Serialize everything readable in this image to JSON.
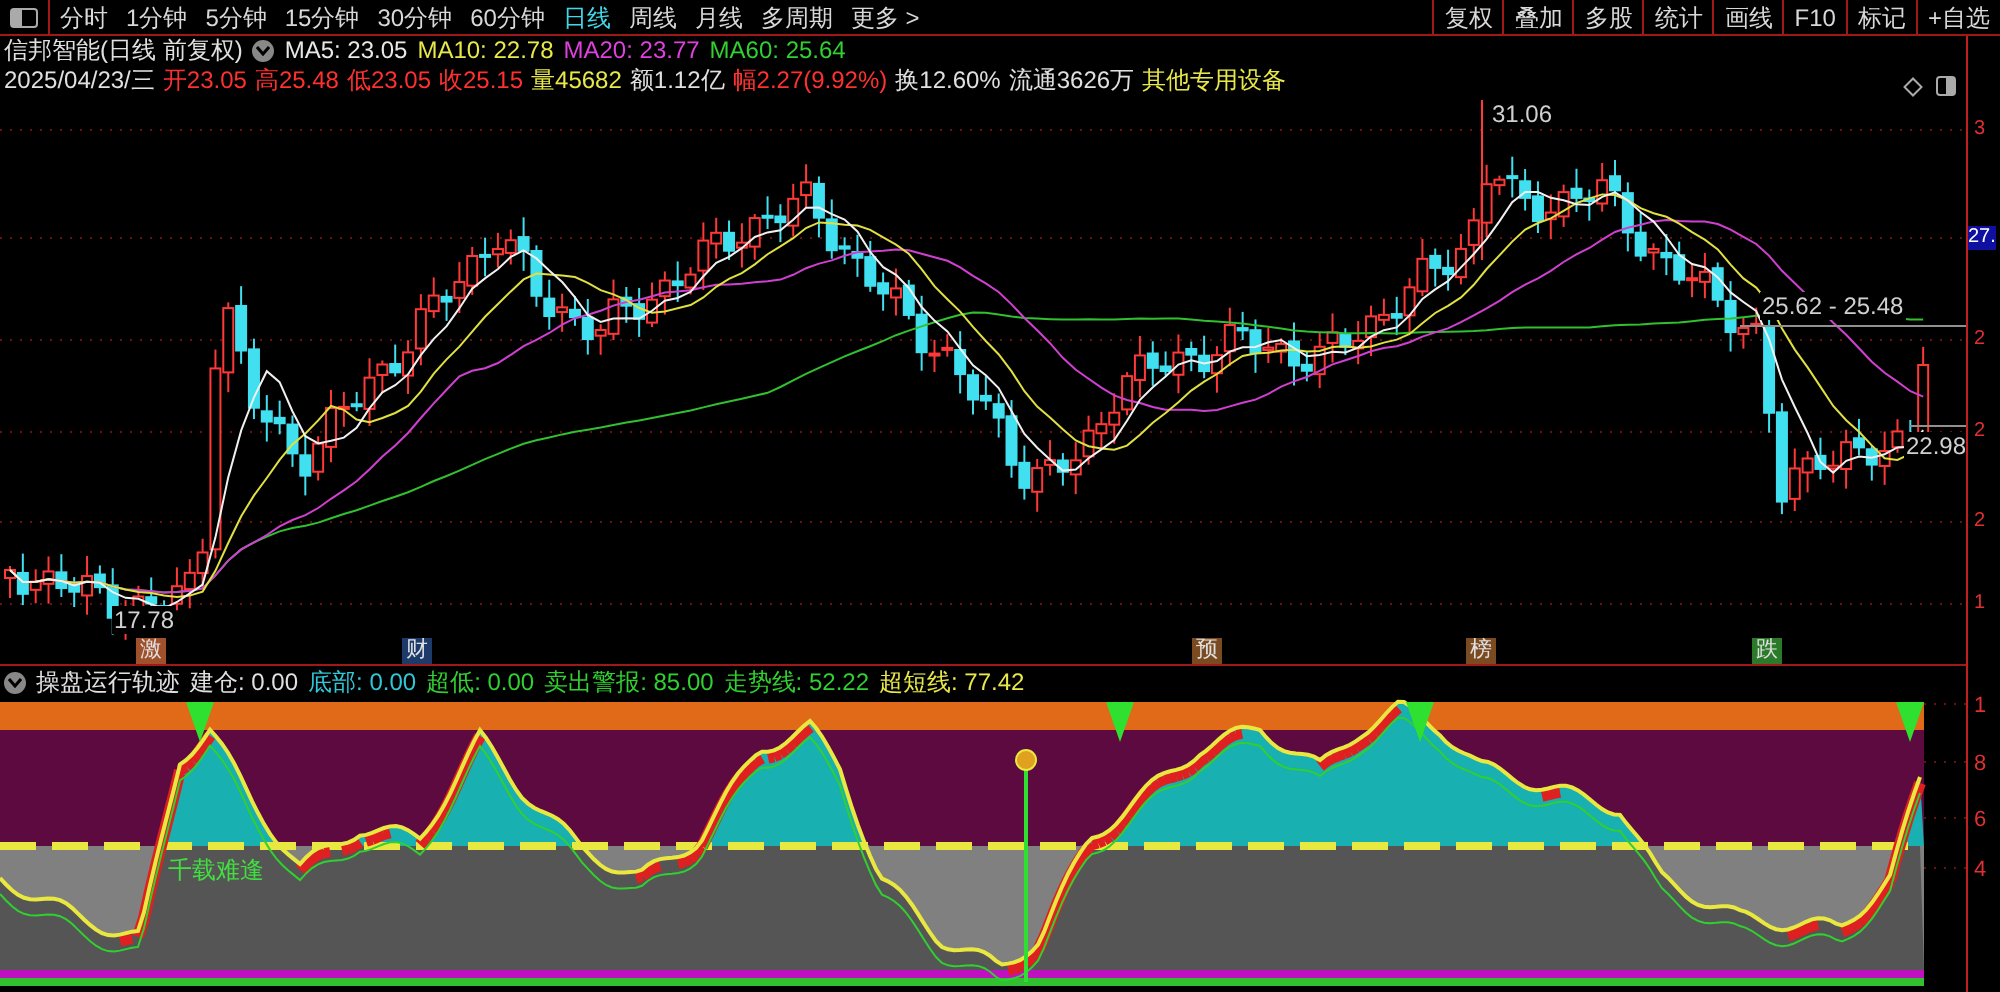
{
  "toolbar": {
    "periods": [
      {
        "label": "分时",
        "selected": false
      },
      {
        "label": "1分钟",
        "selected": false
      },
      {
        "label": "5分钟",
        "selected": false
      },
      {
        "label": "15分钟",
        "selected": false
      },
      {
        "label": "30分钟",
        "selected": false
      },
      {
        "label": "60分钟",
        "selected": false
      },
      {
        "label": "日线",
        "selected": true
      },
      {
        "label": "周线",
        "selected": false
      },
      {
        "label": "月线",
        "selected": false
      },
      {
        "label": "多周期",
        "selected": false
      },
      {
        "label": "更多 >",
        "selected": false
      }
    ],
    "buttons": [
      "复权",
      "叠加",
      "多股",
      "统计",
      "画线",
      "F10",
      "标记",
      "+自选"
    ]
  },
  "price_panel": {
    "title": "信邦智能(日线 前复权)",
    "moving_averages": [
      {
        "label": "MA5: 23.05",
        "color": "#e8e8e8"
      },
      {
        "label": "MA10: 22.78",
        "color": "#e8e84a"
      },
      {
        "label": "MA20: 23.77",
        "color": "#e040e0"
      },
      {
        "label": "MA60: 25.64",
        "color": "#30d030"
      }
    ],
    "quote": [
      {
        "text": "2025/04/23/三",
        "color": "#e0e0e0"
      },
      {
        "text": "开23.05",
        "color": "#ff3030"
      },
      {
        "text": "高25.48",
        "color": "#ff3030"
      },
      {
        "text": "低23.05",
        "color": "#ff3030"
      },
      {
        "text": "收25.15",
        "color": "#ff3030"
      },
      {
        "text": "量45682",
        "color": "#e8e84a"
      },
      {
        "text": "额1.12亿",
        "color": "#e0e0e0"
      },
      {
        "text": "幅2.27(9.92%)",
        "color": "#ff3030"
      },
      {
        "text": "换12.60%",
        "color": "#e0e0e0"
      },
      {
        "text": "流通3626万",
        "color": "#e0e0e0"
      },
      {
        "text": "其他专用设备",
        "color": "#e8e84a"
      }
    ],
    "annotations": {
      "high": "31.06",
      "low": "17.78",
      "range": "25.62 - 25.48",
      "last": "22.98"
    },
    "markers": [
      {
        "text": "激",
        "color": "#a0502a"
      },
      {
        "text": "财",
        "color": "#1c3a6a"
      },
      {
        "text": "预",
        "color": "#7a4a20"
      },
      {
        "text": "榜",
        "color": "#7a4a20"
      },
      {
        "text": "跌",
        "color": "#2a7a2a"
      }
    ],
    "axis_labels": [
      {
        "text": "3",
        "selected": false
      },
      {
        "text": "27.",
        "selected": true
      },
      {
        "text": "2",
        "selected": false
      },
      {
        "text": "2",
        "selected": false
      },
      {
        "text": "2",
        "selected": false
      },
      {
        "text": "1",
        "selected": false
      }
    ]
  },
  "indicator_panel": {
    "title": "操盘运行轨迹",
    "values": [
      {
        "text": "建仓: 0.00",
        "color": "#e0e0e0"
      },
      {
        "text": "底部: 0.00",
        "color": "#30c8d8"
      },
      {
        "text": "超低: 0.00",
        "color": "#30d030"
      },
      {
        "text": "卖出警报: 85.00",
        "color": "#30d030"
      },
      {
        "text": "走势线: 52.22",
        "color": "#30d030"
      },
      {
        "text": "超短线: 77.42",
        "color": "#e8e84a"
      }
    ],
    "signal_text": "千载难逢",
    "axis_labels": [
      "1",
      "8",
      "6",
      "4"
    ]
  }
}
